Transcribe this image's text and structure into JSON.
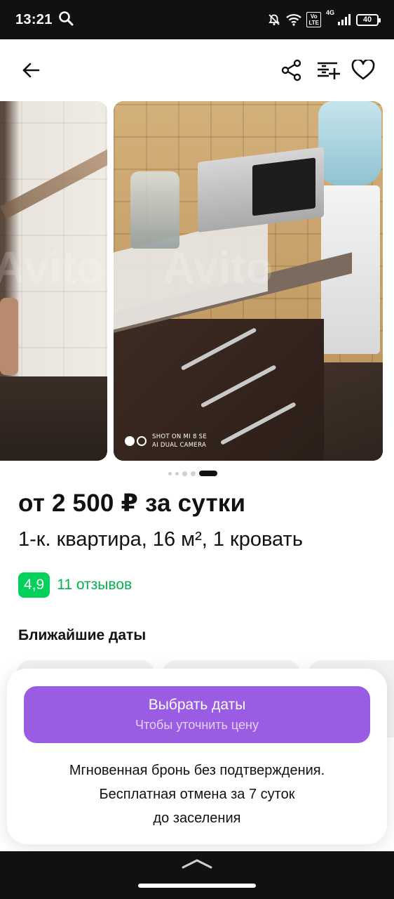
{
  "status_bar": {
    "time": "13:21",
    "volte": "Vo\nLTE",
    "network": "4G",
    "battery": "40",
    "icons": [
      "search-icon",
      "bell-off-icon",
      "wifi-icon",
      "volte-icon",
      "signal-icon",
      "battery-icon"
    ]
  },
  "app_bar": {
    "icons": [
      "back-arrow-icon",
      "share-icon",
      "compare-list-icon",
      "heart-icon"
    ]
  },
  "gallery": {
    "watermark": "Avito",
    "photo_caption_line1": "SHOT ON MI 8 SE",
    "photo_caption_line2": "AI DUAL CAMERA",
    "pager": {
      "total": 5,
      "active_index": 4
    }
  },
  "listing": {
    "price": "от 2 500 ₽ за сутки",
    "subtitle": "1-к. квартира, 16 м², 1 кровать",
    "rating": "4,9",
    "reviews": "11 отзывов",
    "nearest_dates_title": "Ближайшие даты"
  },
  "booking_sheet": {
    "button_title": "Выбрать даты",
    "button_subtitle": "Чтобы уточнить цену",
    "note_line1": "Мгновенная бронь без подтверждения.",
    "note_line2": "Бесплатная отмена за 7 суток",
    "note_line3": "до заселения"
  },
  "colors": {
    "accent_purple": "#9a5ce3",
    "rating_green": "#02d15c",
    "link_green": "#02b150"
  }
}
